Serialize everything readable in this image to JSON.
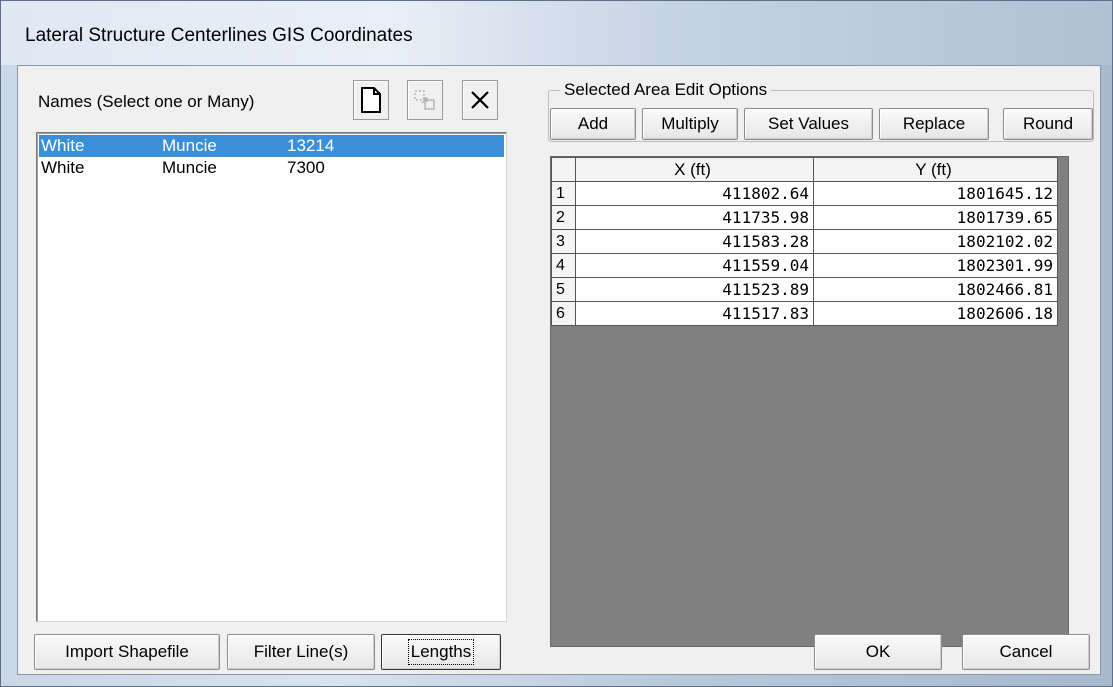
{
  "window": {
    "title": "Lateral Structure Centerlines GIS Coordinates"
  },
  "names": {
    "label": "Names (Select one or Many)",
    "icons": [
      "new-document-icon",
      "copy-disabled-icon",
      "delete-x-icon"
    ],
    "rows": [
      {
        "river": "White",
        "reach": "Muncie",
        "station": "13214",
        "selected": true
      },
      {
        "river": "White",
        "reach": "Muncie",
        "station": "7300",
        "selected": false
      }
    ]
  },
  "edit_options": {
    "label": "Selected Area Edit Options",
    "buttons": [
      "Add",
      "Multiply",
      "Set Values",
      "Replace",
      "Round"
    ]
  },
  "grid": {
    "headers": [
      "X (ft)",
      "Y (ft)"
    ],
    "rows": [
      {
        "n": "1",
        "x": "411802.64",
        "y": "1801645.12"
      },
      {
        "n": "2",
        "x": "411735.98",
        "y": "1801739.65"
      },
      {
        "n": "3",
        "x": "411583.28",
        "y": "1802102.02"
      },
      {
        "n": "4",
        "x": "411559.04",
        "y": "1802301.99"
      },
      {
        "n": "5",
        "x": "411523.89",
        "y": "1802466.81"
      },
      {
        "n": "6",
        "x": "411517.83",
        "y": "1802606.18"
      }
    ]
  },
  "footer": {
    "import": "Import Shapefile",
    "filter": "Filter Line(s)",
    "lengths": "Lengths",
    "ok": "OK",
    "cancel": "Cancel"
  }
}
